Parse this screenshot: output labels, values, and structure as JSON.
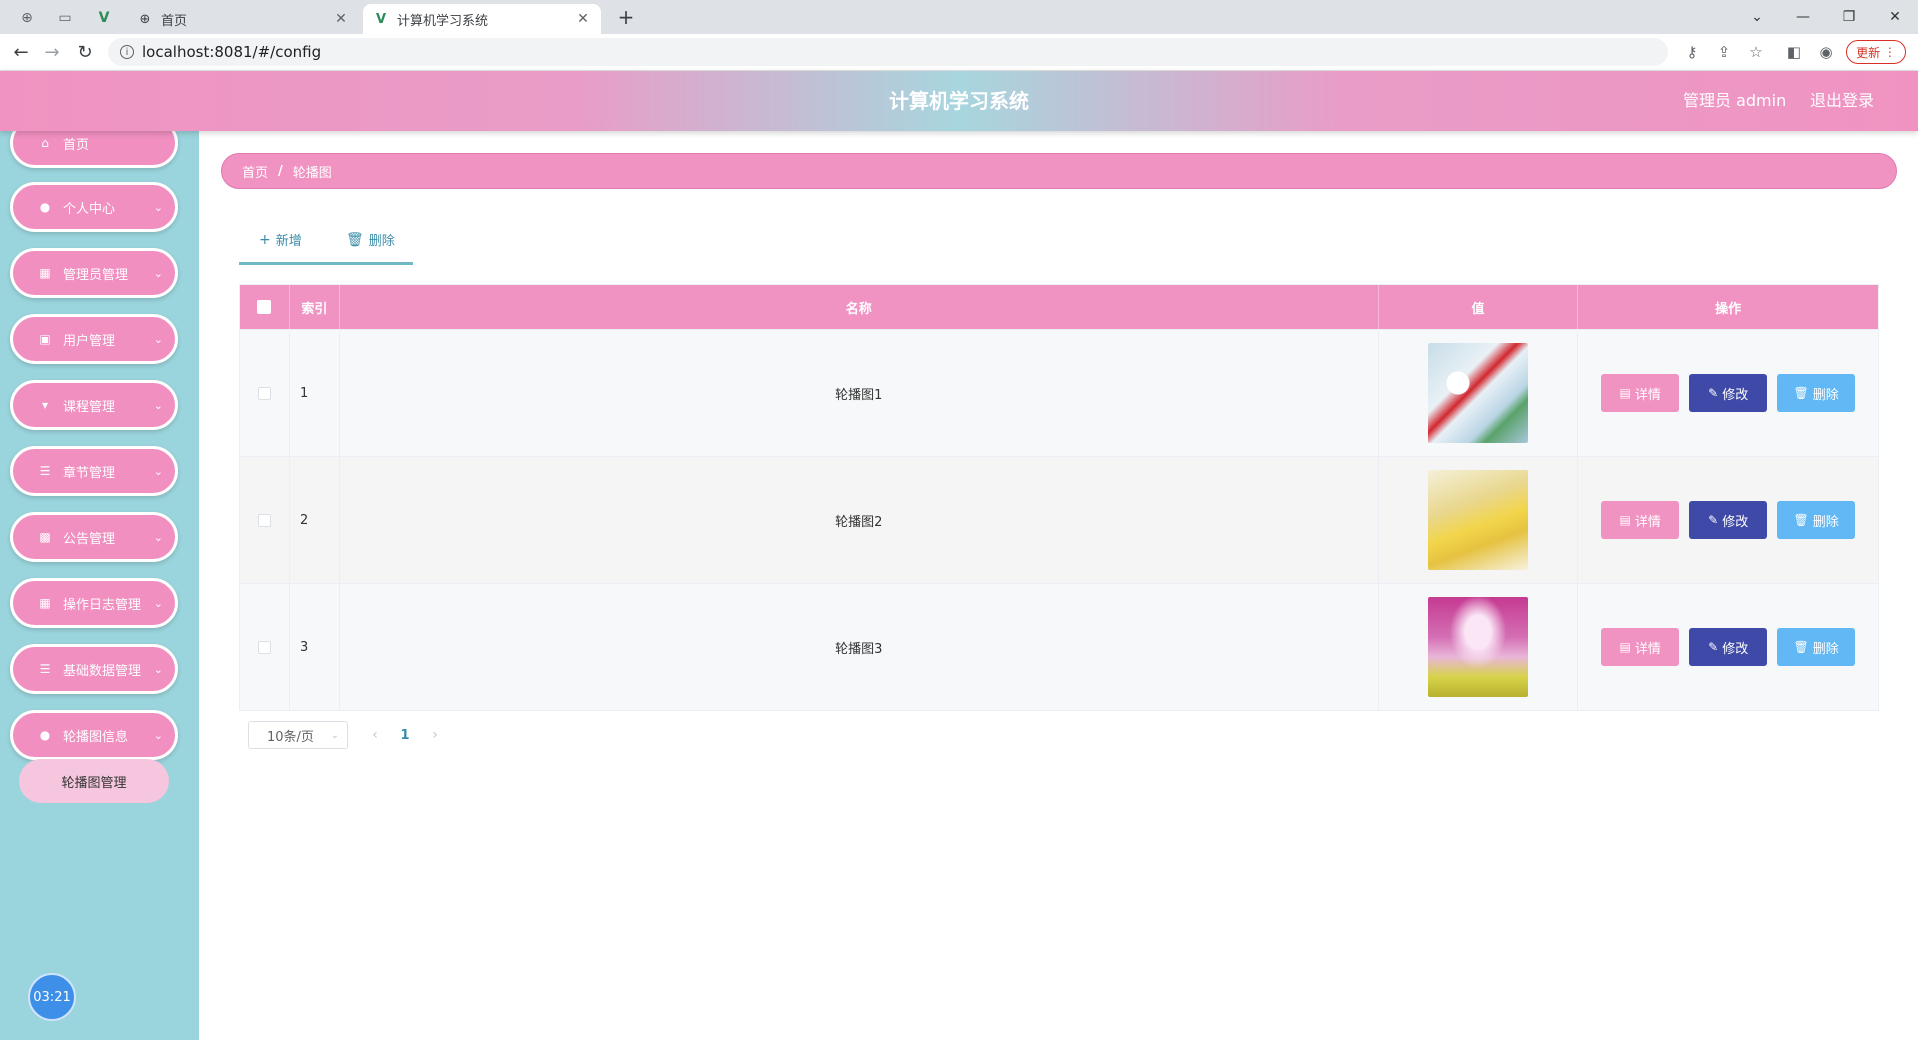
{
  "browser": {
    "tabs": [
      {
        "title": "首页",
        "active": false
      },
      {
        "title": "计算机学习系统",
        "active": true
      }
    ],
    "url": "localhost:8081/#/config",
    "update_label": "更新"
  },
  "header": {
    "title": "计算机学习系统",
    "user": "管理员 admin",
    "logout": "退出登录"
  },
  "sidebar": {
    "items": [
      {
        "label": "首页",
        "icon": "home-icon",
        "has_children": false
      },
      {
        "label": "个人中心",
        "icon": "user-icon",
        "has_children": true
      },
      {
        "label": "管理员管理",
        "icon": "grid-icon",
        "has_children": true
      },
      {
        "label": "用户管理",
        "icon": "clipboard-icon",
        "has_children": true
      },
      {
        "label": "课程管理",
        "icon": "cup-icon",
        "has_children": true
      },
      {
        "label": "章节管理",
        "icon": "list-icon",
        "has_children": true
      },
      {
        "label": "公告管理",
        "icon": "apps-icon",
        "has_children": true
      },
      {
        "label": "操作日志管理",
        "icon": "grid-icon",
        "has_children": true
      },
      {
        "label": "基础数据管理",
        "icon": "list-icon",
        "has_children": true
      },
      {
        "label": "轮播图信息",
        "icon": "bulb-icon",
        "has_children": true
      }
    ],
    "submenu": {
      "label": "轮播图管理"
    },
    "timer": "03:21"
  },
  "breadcrumb": {
    "home": "首页",
    "current": "轮播图"
  },
  "actions": {
    "add": "新增",
    "delete": "删除"
  },
  "table": {
    "columns": {
      "index": "索引",
      "name": "名称",
      "value": "值",
      "ops": "操作"
    },
    "rows": [
      {
        "index": "1",
        "name": "轮播图1"
      },
      {
        "index": "2",
        "name": "轮播图2"
      },
      {
        "index": "3",
        "name": "轮播图3"
      }
    ],
    "ops": {
      "detail": "详情",
      "edit": "修改",
      "delete": "删除"
    }
  },
  "pagination": {
    "page_size": "10条/页",
    "current_page": "1"
  },
  "colors": {
    "primary": "#f093c2",
    "sidebar": "#9ad4dc",
    "edit": "#3f4aa8",
    "delete": "#62b8f5"
  }
}
